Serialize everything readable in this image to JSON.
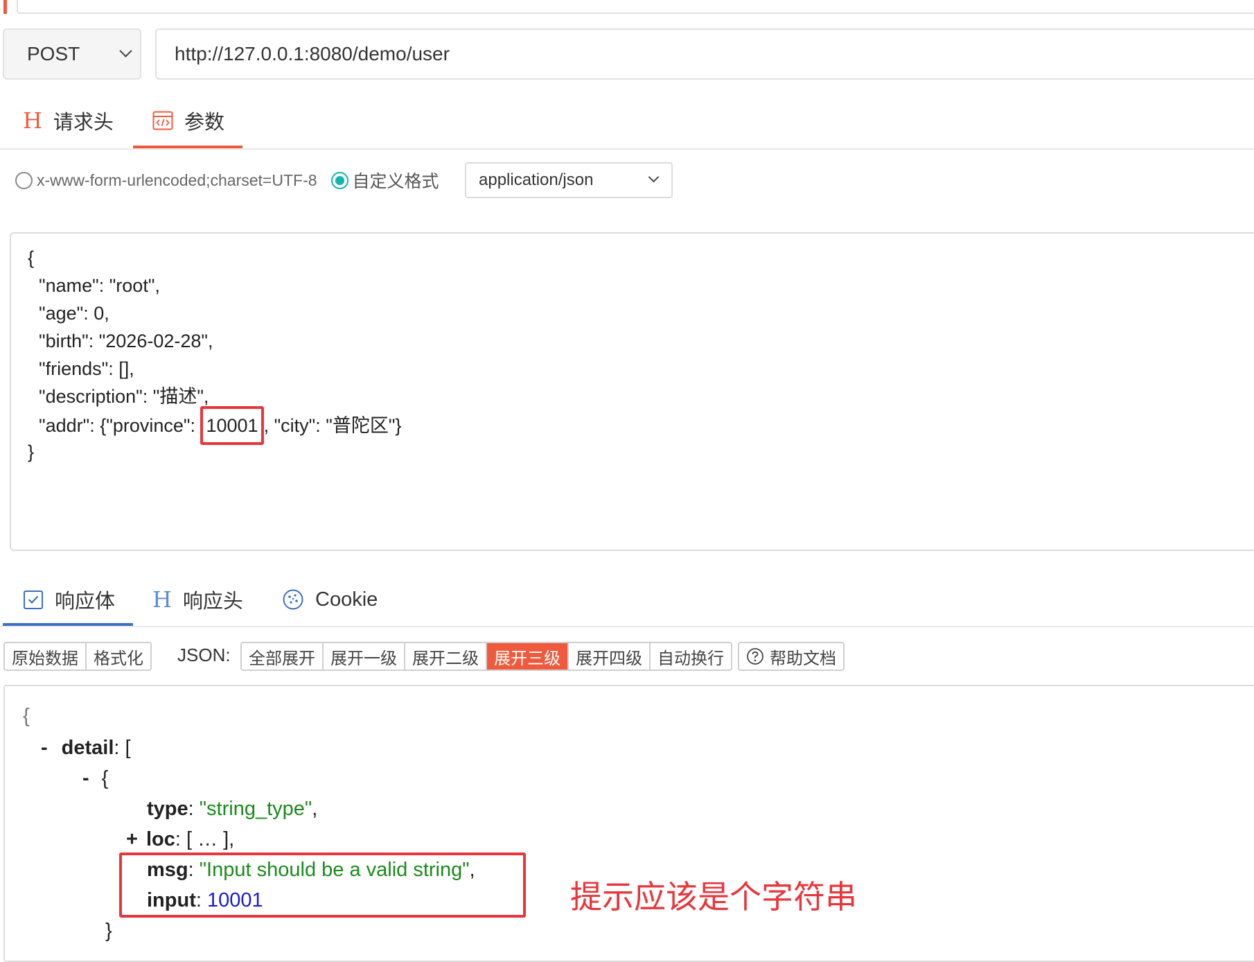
{
  "request": {
    "method": "POST",
    "url": "http://127.0.0.1:8080/demo/user",
    "tabs": [
      {
        "label": "请求头",
        "active": false
      },
      {
        "label": "参数",
        "active": true
      }
    ],
    "encoding": {
      "option_urlencoded": "x-www-form-urlencoded;charset=UTF-8",
      "option_custom": "自定义格式",
      "selected": "custom",
      "content_type": "application/json"
    },
    "body_lines": [
      "{",
      "\"name\": \"root\",",
      "\"age\": 0,",
      "\"birth\": \"2026-02-28\",",
      "\"friends\": [],",
      "\"description\": \"描述\",",
      "\"addr\": {\"province\": ",
      "10001",
      ", \"city\": \"普陀区\"}",
      "}"
    ]
  },
  "response": {
    "tabs": [
      {
        "label": "响应体",
        "active": true
      },
      {
        "label": "响应头",
        "active": false
      },
      {
        "label": "Cookie",
        "active": false
      }
    ],
    "view_buttons": [
      "原始数据",
      "格式化"
    ],
    "json_label": "JSON:",
    "json_buttons": [
      "全部展开",
      "展开一级",
      "展开二级",
      "展开三级",
      "展开四级",
      "自动换行"
    ],
    "json_active": "展开三级",
    "help_label": "帮助文档",
    "tree": {
      "open_brace": "{",
      "detail_toggle": "-",
      "detail_key": "detail",
      "detail_open": ": [",
      "item_toggle": "-",
      "item_open": "{",
      "type_key": "type",
      "type_value": "\"string_type\"",
      "loc_toggle": "+",
      "loc_key": "loc",
      "loc_value": ": [ … ],",
      "msg_key": "msg",
      "msg_value": "\"Input should be a valid string\"",
      "input_key": "input",
      "input_value": "10001",
      "item_close": "}",
      "sep": ": ",
      "comma": ","
    },
    "annotation": "提示应该是个字符串"
  },
  "colors": {
    "accent": "#f05a3c",
    "highlight": "#e8353b",
    "string": "#1a8a1a",
    "number": "#1a1acf",
    "radio_on": "#12b5b0"
  }
}
